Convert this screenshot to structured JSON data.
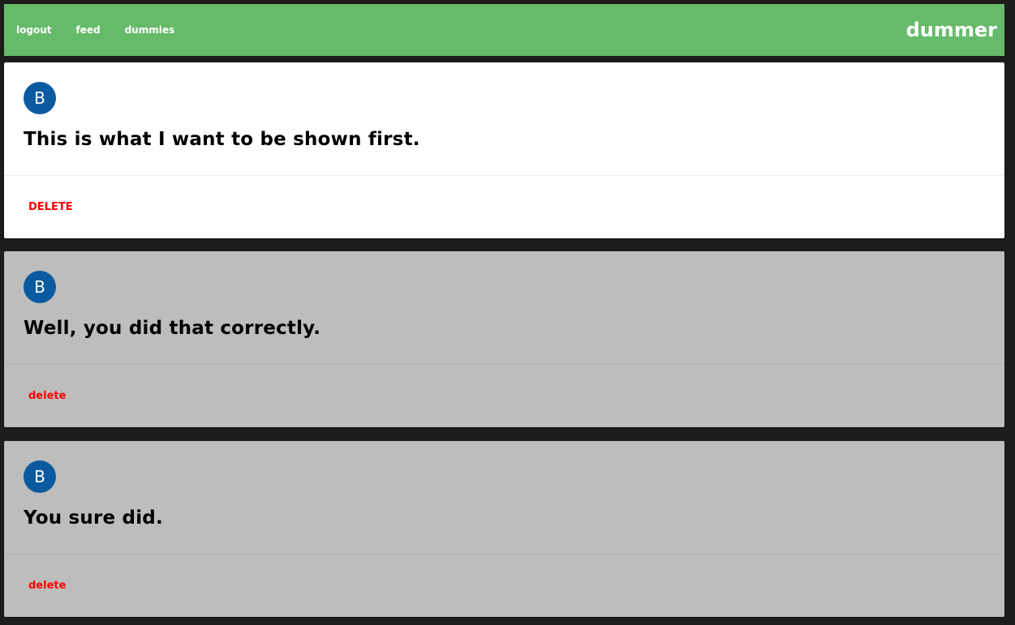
{
  "navbar": {
    "links": [
      "logout",
      "feed",
      "dummies"
    ],
    "brand": "dummer",
    "background": "#66bb6a"
  },
  "posts": [
    {
      "avatar_letter": "B",
      "text": "This is what I want to be shown first.",
      "delete_label": "DELETE",
      "highlighted": true
    },
    {
      "avatar_letter": "B",
      "text": "Well, you did that correctly.",
      "delete_label": "delete",
      "highlighted": false
    },
    {
      "avatar_letter": "B",
      "text": "You sure did.",
      "delete_label": "delete",
      "highlighted": false
    }
  ],
  "colors": {
    "accent": "#66bb6a",
    "avatar": "#0a5aa0",
    "delete": "#ff0000",
    "card_highlight": "#ffffff",
    "card_default": "#bdbdbd",
    "page_background": "#1c1c1a"
  }
}
